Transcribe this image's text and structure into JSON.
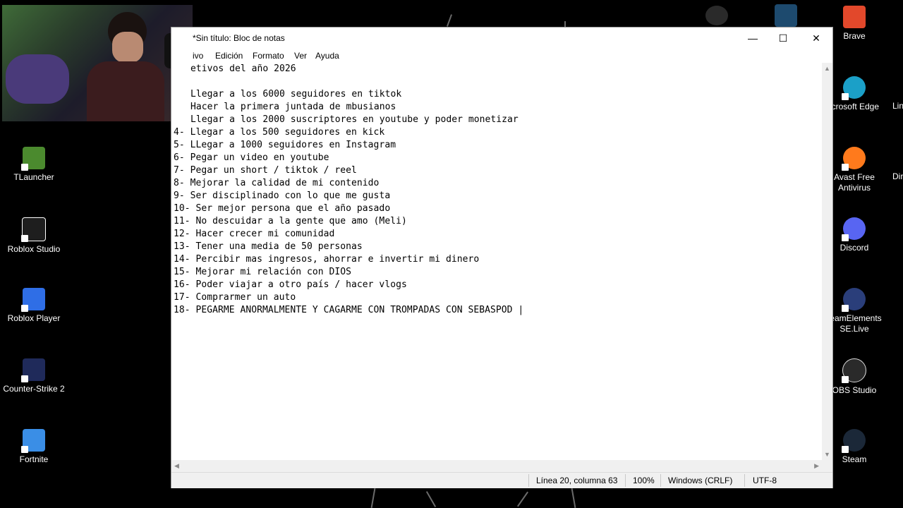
{
  "desktop_left": [
    {
      "label": "TLauncher",
      "color": "#4b8a2e"
    },
    {
      "label": "Roblox Studio",
      "color": "#1e1e1e"
    },
    {
      "label": "Roblox Player",
      "color": "#2f6ee6"
    },
    {
      "label": "Counter-Strike 2",
      "color": "#1f2a5a"
    },
    {
      "label": "Fortnite",
      "color": "#3a8ee6"
    }
  ],
  "desktop_right": [
    {
      "label": "Brave",
      "color": "#e2482b"
    },
    {
      "label": "icrosoft Edge",
      "color": "#1ba0c8"
    },
    {
      "label": "Avast Free Antivirus",
      "color": "#ff7a1c"
    },
    {
      "label": "Discord",
      "color": "#5865f2"
    },
    {
      "label": "reamElements SE.Live",
      "color": "#2a3e7a"
    },
    {
      "label": "OBS Studio",
      "color": "#2a2a2a"
    },
    {
      "label": "Steam",
      "color": "#1b2838"
    }
  ],
  "desktop_far_right": [
    {
      "label": "Lin"
    },
    {
      "label": "Dir"
    }
  ],
  "window": {
    "title": "*Sin título: Bloc de notas",
    "minimize": "—",
    "maximize": "☐",
    "close": "✕"
  },
  "menu": [
    "ivo",
    "Edición",
    "Formato",
    "Ver",
    "Ayuda"
  ],
  "text_lines": [
    "etivos del año 2026",
    "",
    "Llegar a los 6000 seguidores en tiktok",
    "Hacer la primera juntada de mbusianos",
    "Llegar a los 2000 suscriptores en youtube y poder monetizar",
    "4- Llegar a los 500 seguidores en kick",
    "5- LLegar a 1000 seguidores en Instagram",
    "6- Pegar un video en youtube",
    "7- Pegar un short / tiktok / reel",
    "8- Mejorar la calidad de mi contenido",
    "9- Ser disciplinado con lo que me gusta",
    "10- Ser mejor persona que el año pasado",
    "11- No descuidar a la gente que amo (Meli)",
    "12- Hacer crecer mi comunidad",
    "13- Tener una media de 50 personas",
    "14- Percibir mas ingresos, ahorrar e invertir mi dinero",
    "15- Mejorar mi relación con DIOS",
    "16- Poder viajar a otro país / hacer vlogs",
    "17- Comprarmer un auto",
    "18- PEGARME ANORMALMENTE Y CAGARME CON TROMPADAS CON SEBASPOD |"
  ],
  "status": {
    "position": "Línea 20, columna 63",
    "zoom": "100%",
    "line_ending": "Windows (CRLF)",
    "encoding": "UTF-8"
  }
}
